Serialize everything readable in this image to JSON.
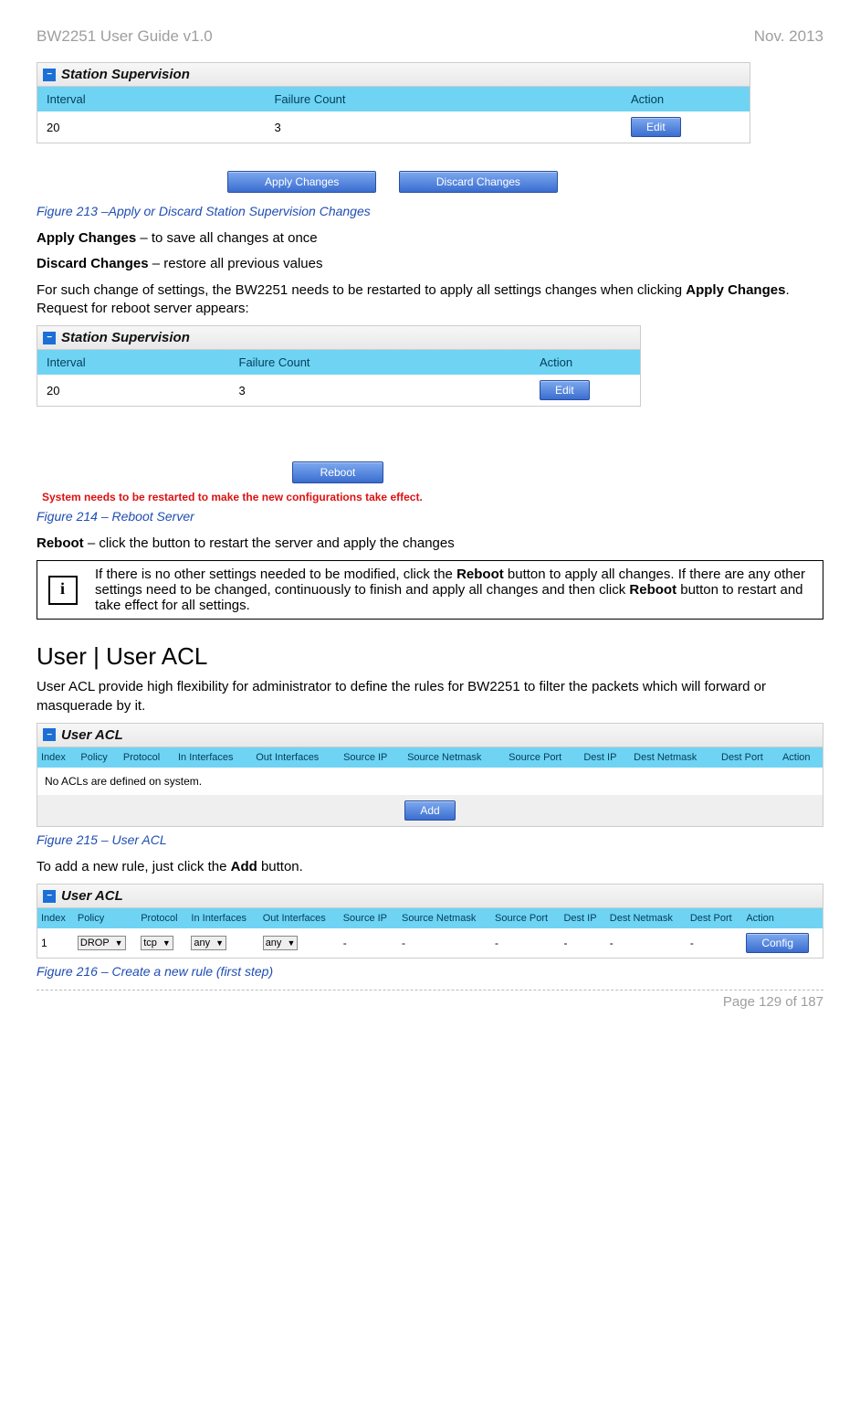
{
  "header": {
    "left": "BW2251 User Guide v1.0",
    "right": "Nov.  2013"
  },
  "fig213": {
    "panel": "Station Supervision",
    "cols": [
      "Interval",
      "Failure Count",
      "Action"
    ],
    "row": [
      "20",
      "3"
    ],
    "edit": "Edit",
    "apply": "Apply Changes",
    "discard": "Discard Changes",
    "caption": "Figure 213 –Apply or Discard Station Supervision Changes"
  },
  "para1": {
    "b": "Apply Changes",
    "t": " – to save all changes at once"
  },
  "para2": {
    "b": "Discard Changes",
    "t": " – restore all previous values"
  },
  "para3a": "For such change of settings, the BW2251 needs to be restarted to apply all settings changes when clicking ",
  "para3b": "Apply Changes",
  "para3c": ". Request for reboot server appears:",
  "fig214": {
    "panel": "Station Supervision",
    "cols": [
      "Interval",
      "Failure Count",
      "Action"
    ],
    "row": [
      "20",
      "3"
    ],
    "edit": "Edit",
    "reboot": "Reboot",
    "sysmsg": "System needs to be restarted to make the new configurations take effect.",
    "caption": "Figure 214 – Reboot Server"
  },
  "para4": {
    "b": "Reboot",
    "t": " – click the button to restart the server and apply the changes"
  },
  "info": {
    "a": "If there is no other settings needed to be modified, click the ",
    "b": "Reboot",
    "c": " button to apply all changes. If there are any other settings need to be changed, continuously to finish and apply all changes and then click ",
    "d": "Reboot",
    "e": " button to restart and take effect  for all settings."
  },
  "h2": "User | User ACL",
  "para5": "User ACL provide high flexibility for administrator to define the rules for BW2251 to filter the packets which will forward or masquerade by it.",
  "fig215": {
    "panel": "User ACL",
    "cols": [
      "Index",
      "Policy",
      "Protocol",
      "In Interfaces",
      "Out Interfaces",
      "Source IP",
      "Source Netmask",
      "Source Port",
      "Dest IP",
      "Dest Netmask",
      "Dest Port",
      "Action"
    ],
    "empty": "No ACLs are defined on system.",
    "add": "Add",
    "caption": "Figure 215 – User ACL"
  },
  "para6a": "To add a new rule, just click the ",
  "para6b": "Add",
  "para6c": " button.",
  "fig216": {
    "panel": "User ACL",
    "cols": [
      "Index",
      "Policy",
      "Protocol",
      "In Interfaces",
      "Out Interfaces",
      "Source IP",
      "Source Netmask",
      "Source Port",
      "Dest IP",
      "Dest Netmask",
      "Dest Port",
      "Action"
    ],
    "row": {
      "index": "1",
      "policy": "DROP",
      "protocol": "tcp",
      "inif": "any",
      "outif": "any",
      "sip": "-",
      "snm": "-",
      "sport": "-",
      "dip": "-",
      "dnm": "-",
      "dport": "-",
      "action": "Config"
    },
    "caption": "Figure 216 – Create a new rule (first step)"
  },
  "footer": "Page 129 of 187"
}
